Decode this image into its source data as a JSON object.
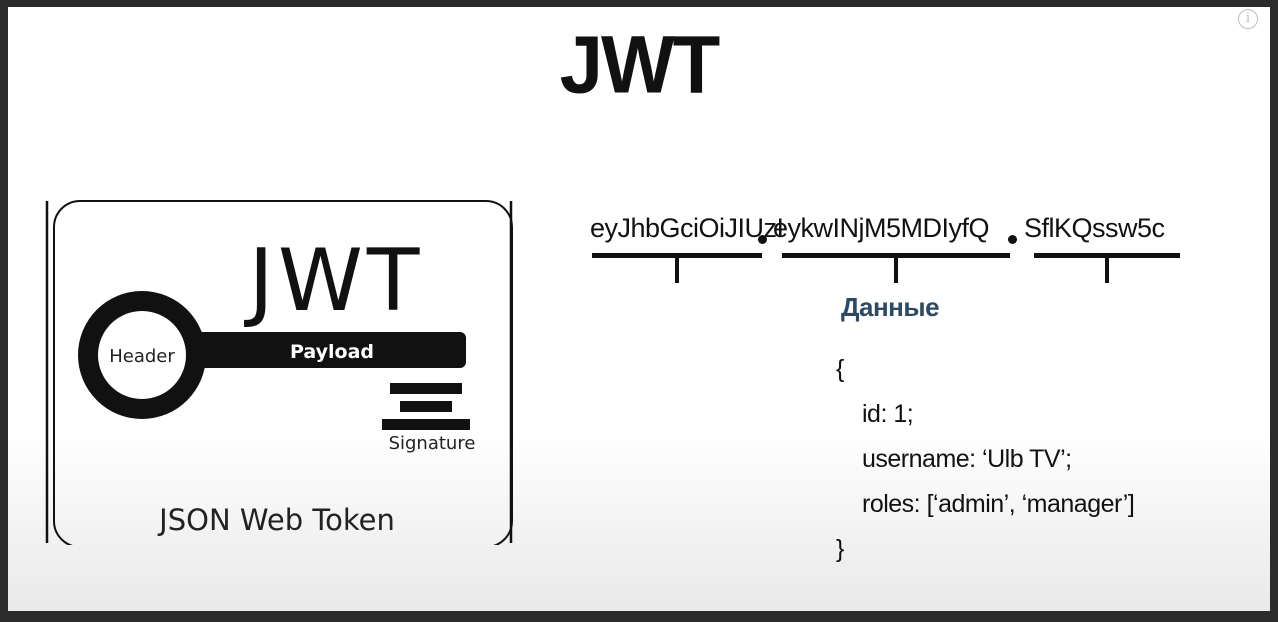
{
  "title": "JWT",
  "info_icon": "info-icon",
  "logo": {
    "title": "JWT",
    "ring_label": "Header",
    "bar_label": "Payload",
    "sig_label": "Signature",
    "caption": "JSON Web Token"
  },
  "token": {
    "header": "eyJhbGciOiJIUzI",
    "payload": "eykwINjM5MDIyfQ",
    "signature": "SflKQssw5c"
  },
  "data_label": "Данные",
  "code": {
    "open": "{",
    "lines": [
      "id: 1;",
      "username: ‘Ulb TV’;",
      "roles: [‘admin’, ‘manager’]"
    ],
    "close": "}"
  }
}
